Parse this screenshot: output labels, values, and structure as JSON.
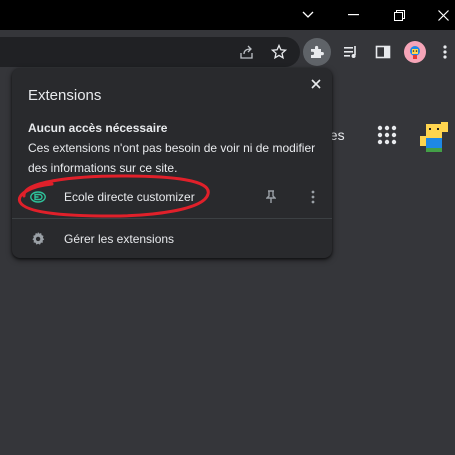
{
  "window": {
    "dropdown_icon": "chevron-down-icon",
    "minimize_icon": "minimize-icon",
    "maximize_icon": "restore-icon",
    "close_icon": "close-icon"
  },
  "toolbar": {
    "icons": [
      "share-icon",
      "star-icon",
      "puzzle-icon",
      "media-control-icon",
      "side-panel-icon",
      "profile-avatar",
      "kebab-menu-icon"
    ]
  },
  "page": {
    "partial_link": "ges"
  },
  "extensions_popup": {
    "title": "Extensions",
    "section_heading": "Aucun accès nécessaire",
    "section_description": "Ces extensions n'ont pas besoin de voir ni de modifier des informations sur ce site.",
    "extensions": [
      {
        "name": "Ecole directe customizer",
        "accent_color": "#2ec29a"
      }
    ],
    "manage_label": "Gérer les extensions"
  },
  "colors": {
    "annotation": "#e0202a",
    "popup_bg": "#292a2d",
    "toolbar_bg": "#35363a"
  }
}
